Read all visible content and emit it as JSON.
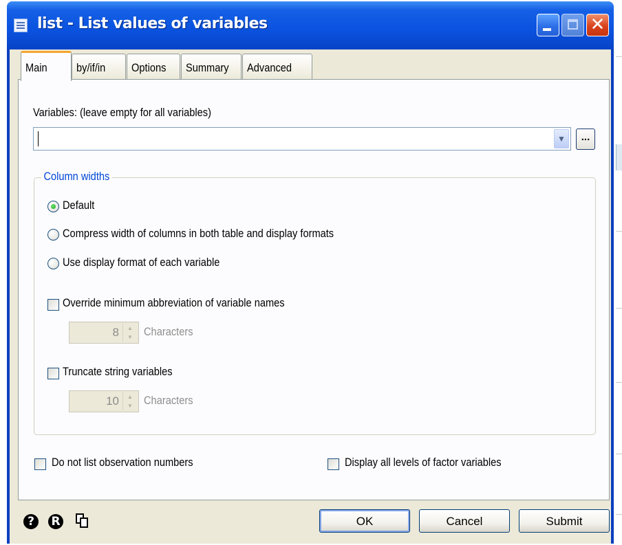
{
  "window": {
    "title": "list - List values of variables"
  },
  "tabs": [
    {
      "label": "Main",
      "active": true
    },
    {
      "label": "by/if/in",
      "active": false
    },
    {
      "label": "Options",
      "active": false
    },
    {
      "label": "Summary",
      "active": false
    },
    {
      "label": "Advanced",
      "active": false
    }
  ],
  "main": {
    "variables_label": "Variables: (leave empty for all variables)",
    "variables_value": "",
    "browse_label": "...",
    "column_widths": {
      "title": "Column widths",
      "options": [
        {
          "label": "Default",
          "selected": true
        },
        {
          "label": "Compress width of columns in both table and display formats",
          "selected": false
        },
        {
          "label": "Use display format of each variable",
          "selected": false
        }
      ]
    },
    "override_abbrev": {
      "label": "Override minimum abbreviation of variable names",
      "checked": false,
      "value": "8",
      "unit": "Characters"
    },
    "truncate_strings": {
      "label": "Truncate string variables",
      "checked": false,
      "value": "10",
      "unit": "Characters"
    },
    "no_obs_numbers": {
      "label": "Do not list observation numbers",
      "checked": false
    },
    "all_factor_levels": {
      "label": "Display all levels of factor variables",
      "checked": false
    }
  },
  "footer": {
    "help_icon": "?",
    "reset_icon": "R",
    "ok_label": "OK",
    "cancel_label": "Cancel",
    "submit_label": "Submit"
  },
  "colors": {
    "titlebar": "#0a52df",
    "dialog_bg": "#ece9d8",
    "groupbox_title": "#0046d5",
    "radio_selected": "#21a121"
  }
}
